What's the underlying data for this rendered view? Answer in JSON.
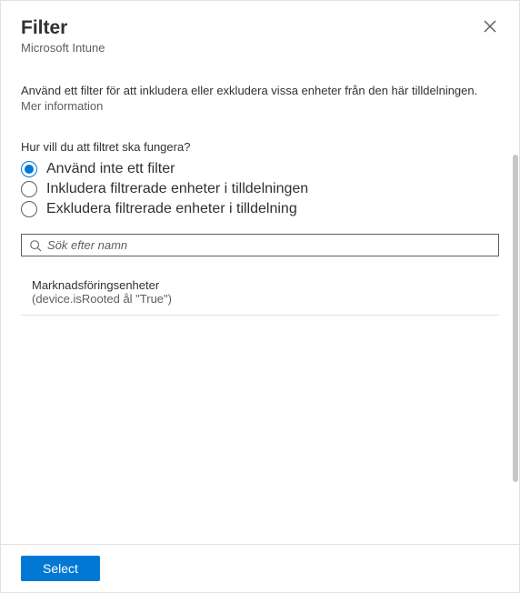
{
  "header": {
    "title": "Filter",
    "subtitle": "Microsoft Intune"
  },
  "description": "Använd ett filter för att inkludera eller exkludera vissa enheter från den här tilldelningen.",
  "moreInfo": "Mer information",
  "question": "Hur vill du att filtret ska fungera?",
  "options": [
    {
      "label": "Använd inte ett filter",
      "selected": true
    },
    {
      "label": "Inkludera filtrerade enheter i tilldelningen",
      "selected": false
    },
    {
      "label": "Exkludera filtrerade enheter i tilldelning",
      "selected": false
    }
  ],
  "search": {
    "placeholder": "Sök efter namn"
  },
  "filters": [
    {
      "name": "Marknadsföringsenheter",
      "rule": "(device.isRooted ål \"True\")"
    }
  ],
  "footer": {
    "select": "Select"
  }
}
